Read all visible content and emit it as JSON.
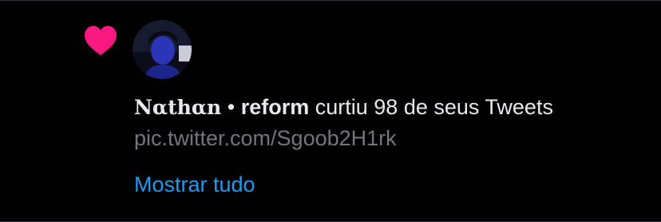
{
  "notification": {
    "icon": "heart-icon",
    "icon_color": "#f91880",
    "user": {
      "display_name": "Nαthαn",
      "separator": "•",
      "handle_part": "reform"
    },
    "action_text": "curtiu 98 de seus Tweets",
    "tweet_link": "pic.twitter.com/Sgoob2H1rk",
    "show_all_label": "Mostrar tudo"
  },
  "colors": {
    "background": "#000000",
    "primary_text": "#e7e9ea",
    "secondary_text": "#71767b",
    "link": "#1d9bf0"
  }
}
